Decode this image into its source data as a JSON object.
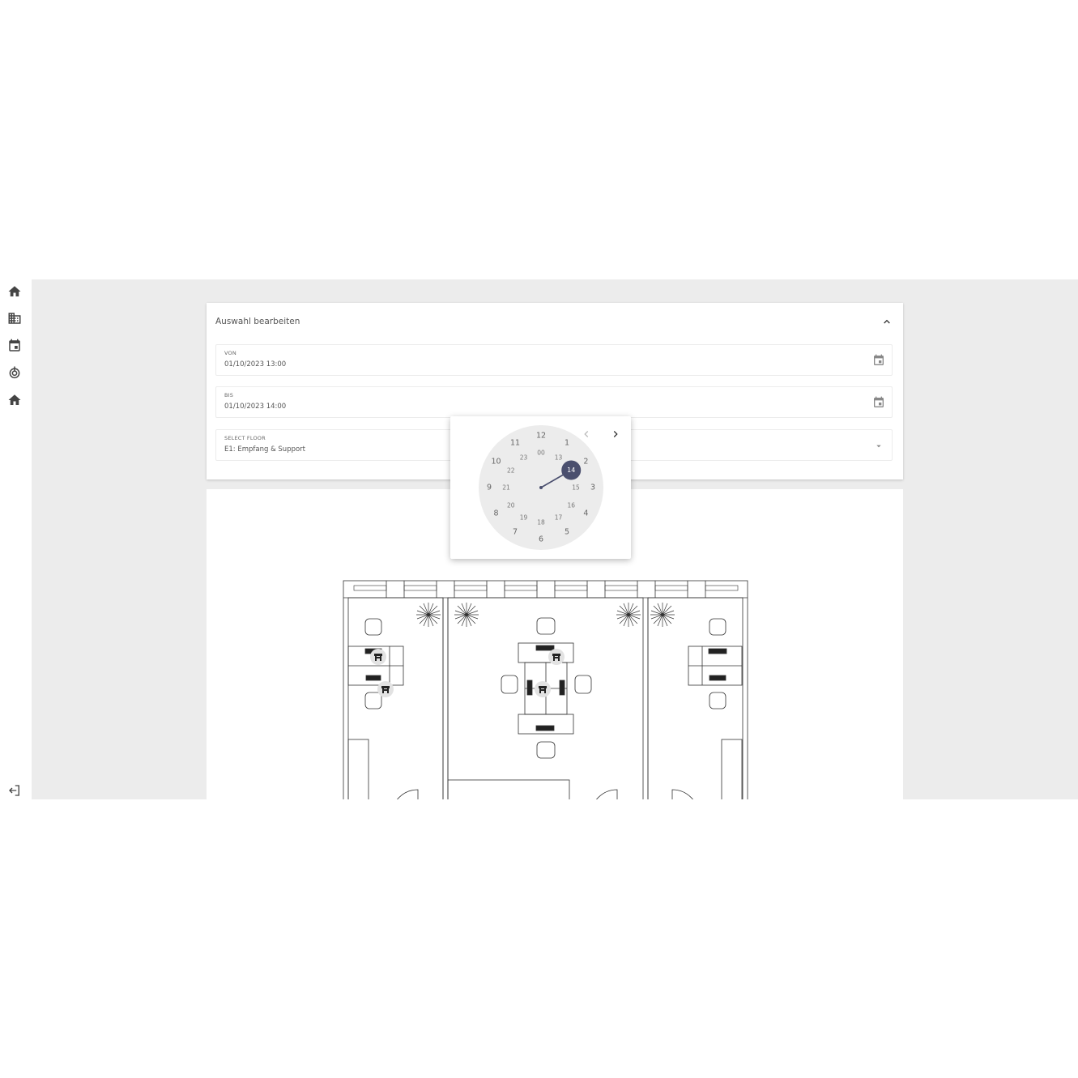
{
  "sidebar": {
    "items": [
      {
        "icon": "home-icon"
      },
      {
        "icon": "building-icon"
      },
      {
        "icon": "calendar-icon"
      },
      {
        "icon": "power-icon"
      },
      {
        "icon": "home-icon"
      }
    ],
    "logout_icon": "logout-icon"
  },
  "panel": {
    "title": "Auswahl bearbeiten",
    "collapse_icon": "chevron-up-icon",
    "fields": {
      "from": {
        "label": "VON",
        "value": "01/10/2023 13:00",
        "icon": "calendar-icon"
      },
      "to": {
        "label": "BIS",
        "value": "01/10/2023 14:00",
        "icon": "calendar-icon"
      },
      "floor": {
        "label": "SELECT FLOOR",
        "value": "E1: Empfang & Support",
        "icon": "caret-down-icon"
      }
    }
  },
  "clock": {
    "selected": "14",
    "outer": [
      "12",
      "1",
      "2",
      "3",
      "4",
      "5",
      "6",
      "7",
      "8",
      "9",
      "10",
      "11"
    ],
    "inner": [
      "00",
      "13",
      "14",
      "15",
      "16",
      "17",
      "18",
      "19",
      "20",
      "21",
      "22",
      "23"
    ],
    "prev_icon": "chevron-left-icon",
    "next_icon": "chevron-right-icon",
    "accent": "#4a4f6e",
    "face_color": "#ececec"
  },
  "floorplan": {
    "seats": [
      {
        "icon": "chair-icon"
      },
      {
        "icon": "chair-icon"
      },
      {
        "icon": "chair-icon"
      },
      {
        "icon": "chair-icon"
      }
    ]
  }
}
